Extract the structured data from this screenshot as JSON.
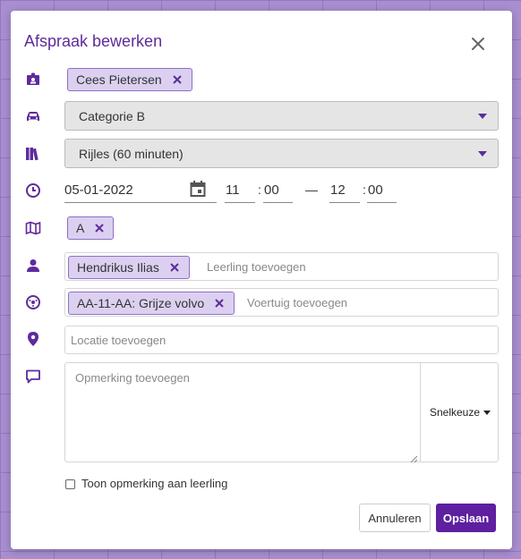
{
  "modal": {
    "title": "Afspraak bewerken"
  },
  "instructor": {
    "chip": "Cees Pietersen"
  },
  "category": {
    "value": "Categorie B"
  },
  "lesson_type": {
    "value": "Rijles (60 minuten)"
  },
  "datetime": {
    "date": "05-01-2022",
    "start_hour": "11",
    "start_min": "00",
    "dash": "—",
    "end_hour": "12",
    "end_min": "00",
    "colon": ":"
  },
  "route": {
    "chip": "A"
  },
  "student": {
    "chip": "Hendrikus Ilias",
    "placeholder": "Leerling toevoegen"
  },
  "vehicle": {
    "chip": "AA-11-AA: Grijze volvo",
    "placeholder": "Voertuig toevoegen"
  },
  "location": {
    "placeholder": "Locatie toevoegen"
  },
  "remark": {
    "placeholder": "Opmerking toevoegen",
    "quick_label": "Snelkeuze"
  },
  "show_remark": {
    "label": "Toon opmerking aan leerling",
    "checked": false
  },
  "buttons": {
    "cancel": "Annuleren",
    "save": "Opslaan"
  },
  "colors": {
    "accent": "#5e2b9c",
    "chip_bg": "#dcd0f0",
    "save_bg": "#5e1fa0"
  }
}
